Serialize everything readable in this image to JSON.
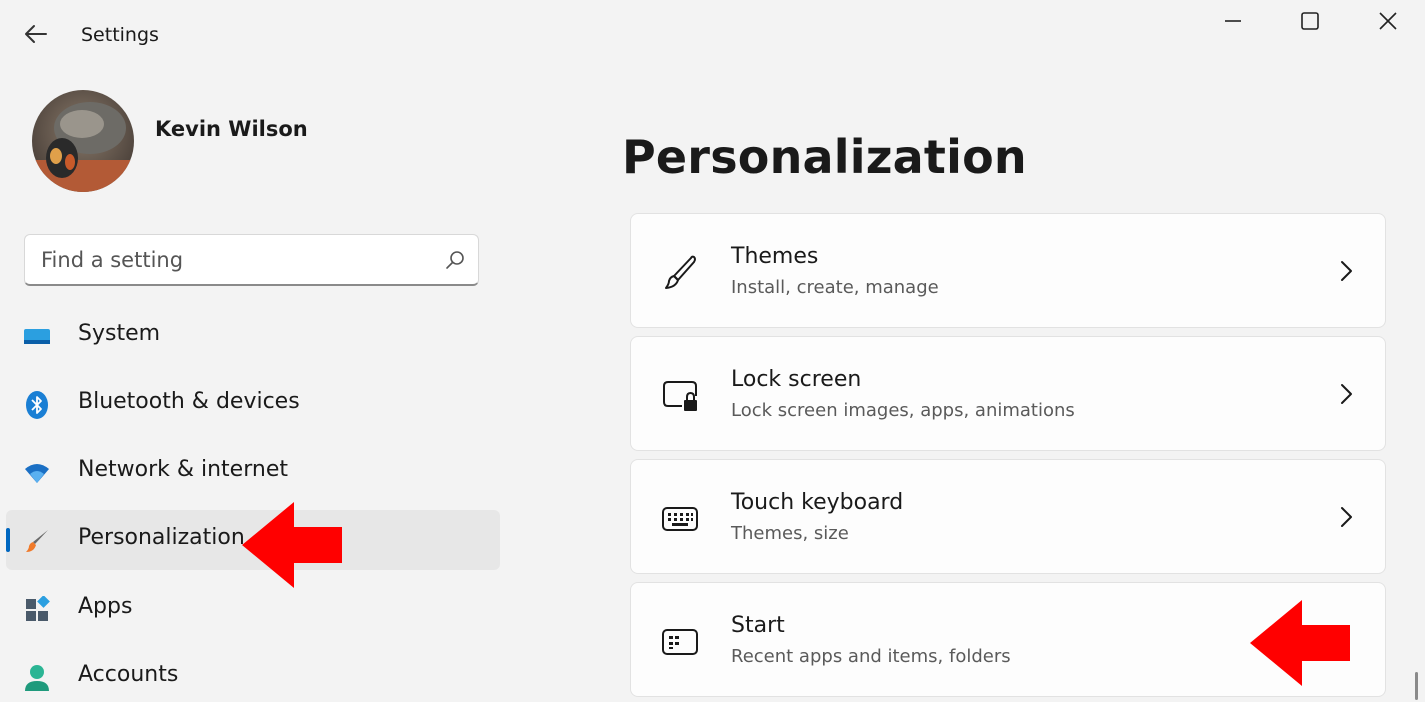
{
  "window": {
    "title": "Settings"
  },
  "profile": {
    "name": "Kevin Wilson"
  },
  "search": {
    "placeholder": "Find a setting"
  },
  "sidebar": {
    "items": [
      {
        "label": "System",
        "icon": "system-display-icon"
      },
      {
        "label": "Bluetooth & devices",
        "icon": "bluetooth-icon"
      },
      {
        "label": "Network & internet",
        "icon": "wifi-icon"
      },
      {
        "label": "Personalization",
        "icon": "paintbrush-icon",
        "active": true
      },
      {
        "label": "Apps",
        "icon": "apps-icon"
      },
      {
        "label": "Accounts",
        "icon": "accounts-icon"
      }
    ]
  },
  "main": {
    "title": "Personalization",
    "cards": [
      {
        "title": "Themes",
        "subtitle": "Install, create, manage",
        "icon": "brush-icon"
      },
      {
        "title": "Lock screen",
        "subtitle": "Lock screen images, apps, animations",
        "icon": "lock-screen-icon"
      },
      {
        "title": "Touch keyboard",
        "subtitle": "Themes, size",
        "icon": "keyboard-icon"
      },
      {
        "title": "Start",
        "subtitle": "Recent apps and items, folders",
        "icon": "start-menu-icon"
      }
    ]
  },
  "colors": {
    "accent": "#0067c0",
    "annotation_arrow": "#ff0000",
    "background": "#f3f3f3"
  }
}
